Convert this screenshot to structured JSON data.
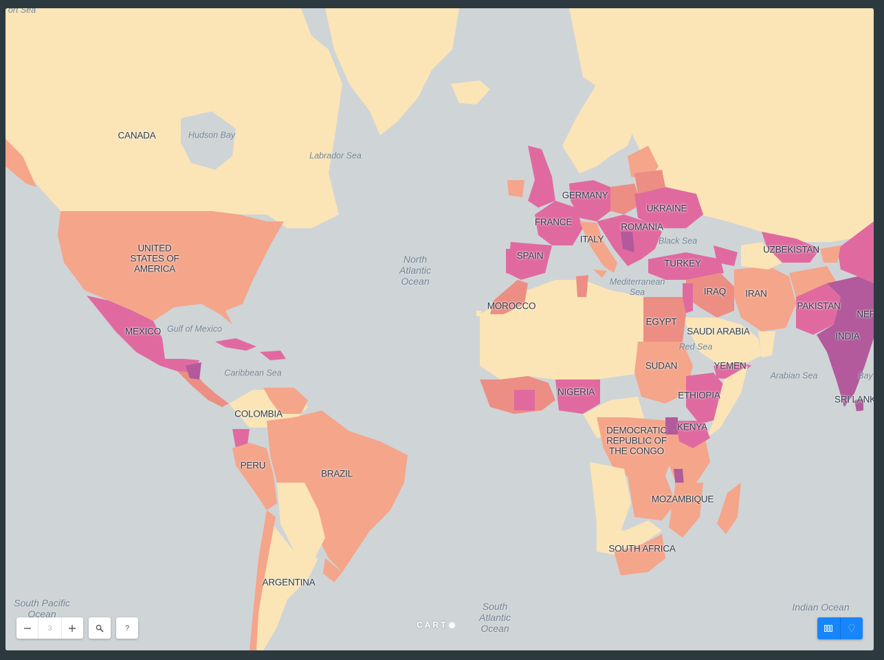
{
  "map": {
    "countries": [
      "CANADA",
      "UNITED STATES OF AMERICA",
      "MEXICO",
      "COLOMBIA",
      "PERU",
      "BRAZIL",
      "ARGENTINA",
      "GERMANY",
      "FRANCE",
      "SPAIN",
      "ITALY",
      "UKRAINE",
      "ROMANIA",
      "TURKEY",
      "MOROCCO",
      "EGYPT",
      "SAUDI ARABIA",
      "IRAQ",
      "IRAN",
      "UZBEKISTAN",
      "PAKISTAN",
      "NEP",
      "INDIA",
      "SRI LANK",
      "YEMEN",
      "SUDAN",
      "ETHIOPIA",
      "NIGERIA",
      "KENYA",
      "DEMOCRATIC REPUBLIC OF THE CONGO",
      "MOZAMBIQUE",
      "SOUTH AFRICA"
    ],
    "labels": {
      "canada": "CANADA",
      "usa_1": "UNITED",
      "usa_2": "STATES OF",
      "usa_3": "AMERICA",
      "mexico": "MEXICO",
      "colombia": "COLOMBIA",
      "peru": "PERU",
      "brazil": "BRAZIL",
      "argentina": "ARGENTINA",
      "germany": "GERMANY",
      "france": "FRANCE",
      "spain": "SPAIN",
      "italy": "ITALY",
      "ukraine": "UKRAINE",
      "romania": "ROMANIA",
      "turkey": "TURKEY",
      "morocco": "MOROCCO",
      "egypt": "EGYPT",
      "saudi": "SAUDI ARABIA",
      "iraq": "IRAQ",
      "iran": "IRAN",
      "uzbekistan": "UZBEKISTAN",
      "pakistan": "PAKISTAN",
      "nepal": "NEP",
      "india": "INDIA",
      "srilanka": "SRI LANK",
      "yemen": "YEMEN",
      "sudan": "SUDAN",
      "ethiopia": "ETHIOPIA",
      "nigeria": "NIGERIA",
      "kenya": "KENYA",
      "drc_1": "DEMOCRATIC",
      "drc_2": "REPUBLIC OF",
      "drc_3": "THE CONGO",
      "mozambique": "MOZAMBIQUE",
      "southafrica": "SOUTH AFRICA"
    },
    "water": {
      "fort_sea": "ort Sea",
      "hudson": "Hudson Bay",
      "labrador": "Labrador Sea",
      "nat_1": "North",
      "nat_2": "Atlantic",
      "nat_3": "Ocean",
      "gulf_mexico": "Gulf of Mexico",
      "caribbean": "Caribbean Sea",
      "black_sea": "Black Sea",
      "med_1": "Mediterranean",
      "med_2": "Sea",
      "red_sea": "Red Sea",
      "arabian": "Arabian Sea",
      "bay": "Bay",
      "spo_1": "South Pacific",
      "spo_2": "Ocean",
      "sat_1": "South",
      "sat_2": "Atlantic",
      "sat_3": "Ocean",
      "indian": "Indian Ocean"
    },
    "colors": {
      "water": "#cfd4d7",
      "level_0": "#fbe5b6",
      "level_1": "#f5a58a",
      "level_2": "#ec8e84",
      "level_3": "#e06aa0",
      "level_4": "#b25a9b"
    }
  },
  "controls": {
    "zoom_out_icon": "minus-icon",
    "zoom_level": "3",
    "zoom_in_icon": "plus-icon",
    "search_icon": "search-icon",
    "help_label": "?",
    "logo_text": "CART",
    "layer_icon_1": "columns-icon",
    "layer_icon_2": "pin-icon",
    "accent": "#1785fb"
  }
}
